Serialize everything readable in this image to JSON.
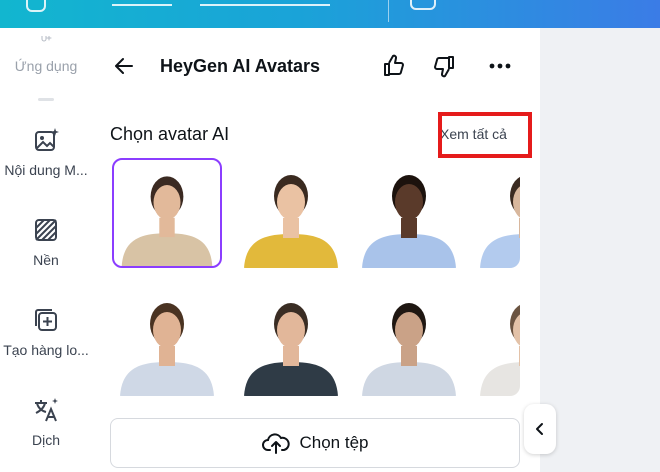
{
  "sidebar": {
    "items": [
      {
        "label": "Ứng dụng",
        "icon": "apps-icon"
      },
      {
        "label": "Nội dung M...",
        "icon": "magic-media-icon"
      },
      {
        "label": "Nền",
        "icon": "background-icon"
      },
      {
        "label": "Tạo hàng lo...",
        "icon": "bulk-create-icon"
      },
      {
        "label": "Dịch",
        "icon": "translate-icon"
      }
    ]
  },
  "panel": {
    "title": "HeyGen AI Avatars",
    "section_title": "Chọn avatar AI",
    "see_all_label": "Xem tất cả",
    "upload_label": "Chọn tệp"
  },
  "avatars": [
    {
      "shirt": "#d8c3a5",
      "skin": "#e2b99a",
      "hair": "#3b2a22",
      "selected": true
    },
    {
      "shirt": "#e2b93b",
      "skin": "#eac2a3",
      "hair": "#3a2a20",
      "selected": false
    },
    {
      "shirt": "#a9c3ea",
      "skin": "#5a3a2a",
      "hair": "#1c120d",
      "selected": false
    },
    {
      "shirt": "#b3cbee",
      "skin": "#d8b79d",
      "hair": "#3a2a20",
      "selected": false
    },
    {
      "shirt": "#cfd8e6",
      "skin": "#e0b394",
      "hair": "#4a3322",
      "selected": false
    },
    {
      "shirt": "#2f3b46",
      "skin": "#e2b79a",
      "hair": "#3a2d24",
      "selected": false
    },
    {
      "shirt": "#cfd7e3",
      "skin": "#caa287",
      "hair": "#1f1712",
      "selected": false
    },
    {
      "shirt": "#e7e5e2",
      "skin": "#e3c2a8",
      "hair": "#6b5441",
      "selected": false
    }
  ],
  "colors": {
    "accent": "#8b3dff",
    "highlight": "#e51b1b",
    "topbar_start": "#12b6cf",
    "topbar_end": "#3b7ce6"
  }
}
